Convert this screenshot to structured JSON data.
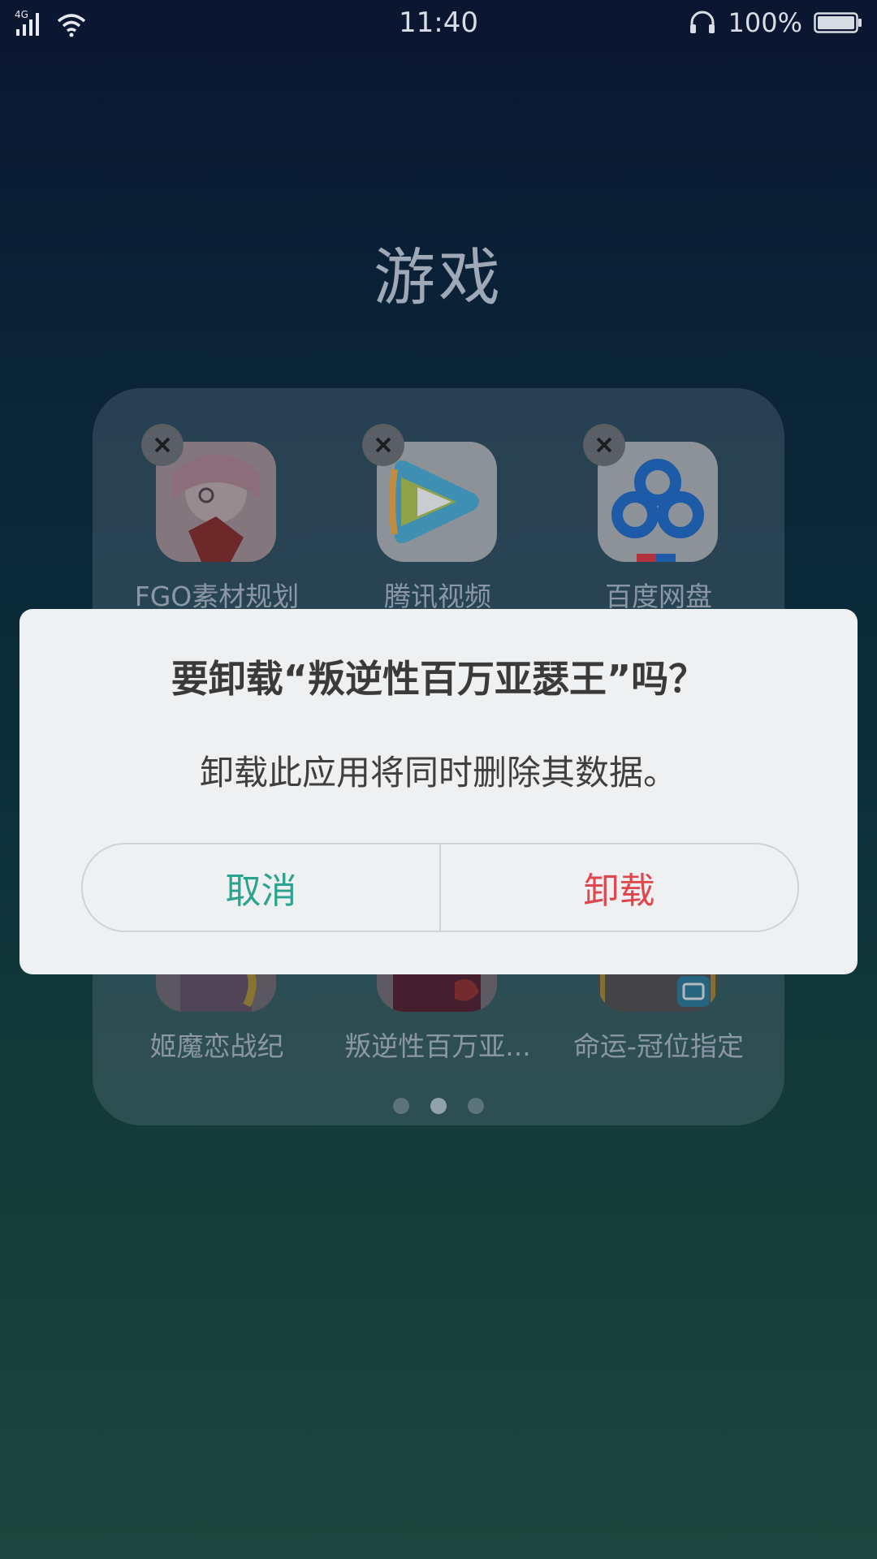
{
  "status_bar": {
    "network": "4G",
    "time": "11:40",
    "battery": "100%",
    "icons": [
      "signal-icon",
      "wifi-icon",
      "headphone-icon",
      "battery-icon"
    ]
  },
  "folder": {
    "title": "游戏",
    "apps": [
      {
        "label": "FGO素材规划",
        "icon": "fgo-app-icon"
      },
      {
        "label": "腾讯视频",
        "icon": "tencent-video-icon"
      },
      {
        "label": "百度网盘",
        "icon": "baidu-netdisk-icon"
      },
      {
        "label": "姬魔恋战纪",
        "icon": "game-app-icon"
      },
      {
        "label": "叛逆性百万亚...",
        "icon": "game-app-icon"
      },
      {
        "label": "命运-冠位指定",
        "icon": "fate-grand-order-icon"
      }
    ],
    "page_count": 3,
    "active_page": 2
  },
  "dialog": {
    "title": "要卸载“叛逆性百万亚瑟王”吗？",
    "message": "卸载此应用将同时删除其数据。",
    "cancel_label": "取消",
    "uninstall_label": "卸载",
    "colors": {
      "cancel": "#2aa48e",
      "uninstall": "#e0474c"
    }
  }
}
